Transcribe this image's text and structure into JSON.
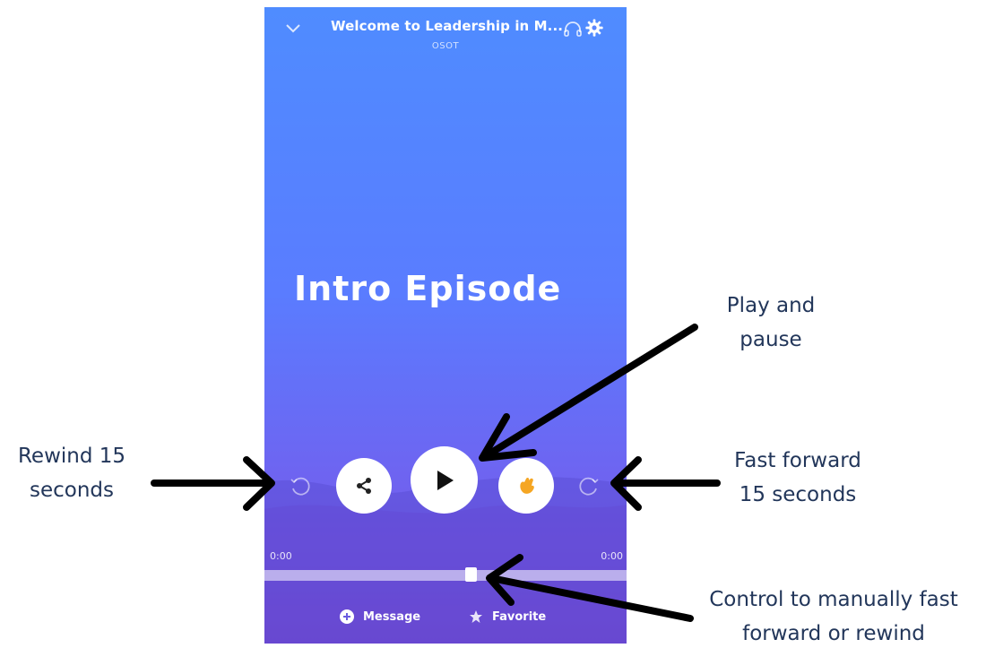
{
  "player": {
    "header": {
      "title": "Welcome to Leadership in M...",
      "subtitle": "OSOT"
    },
    "episode_title": "Intro Episode",
    "time_elapsed": "0:00",
    "time_total": "0:00",
    "progress_fraction": 0.57,
    "bottom": {
      "message_label": "Message",
      "favorite_label": "Favorite"
    },
    "colors": {
      "gradient_top": "#4f8cff",
      "gradient_bottom": "#7a4fd6",
      "clap_accent": "#f5a623"
    }
  },
  "annotations": {
    "play_pause": [
      "Play and",
      "pause"
    ],
    "rewind": [
      "Rewind 15",
      "seconds"
    ],
    "fast_forward": [
      "Fast forward",
      "15 seconds"
    ],
    "scrub_control": [
      "Control to manually fast",
      "forward or rewind"
    ]
  },
  "icons": {
    "collapse": "chevron-down-icon",
    "headphones": "headphones-icon",
    "settings": "gear-icon",
    "rewind": "rewind-15-icon",
    "forward": "forward-15-icon",
    "share": "share-icon",
    "play": "play-icon",
    "clap": "clap-icon",
    "message": "message-icon",
    "favorite": "star-icon"
  }
}
